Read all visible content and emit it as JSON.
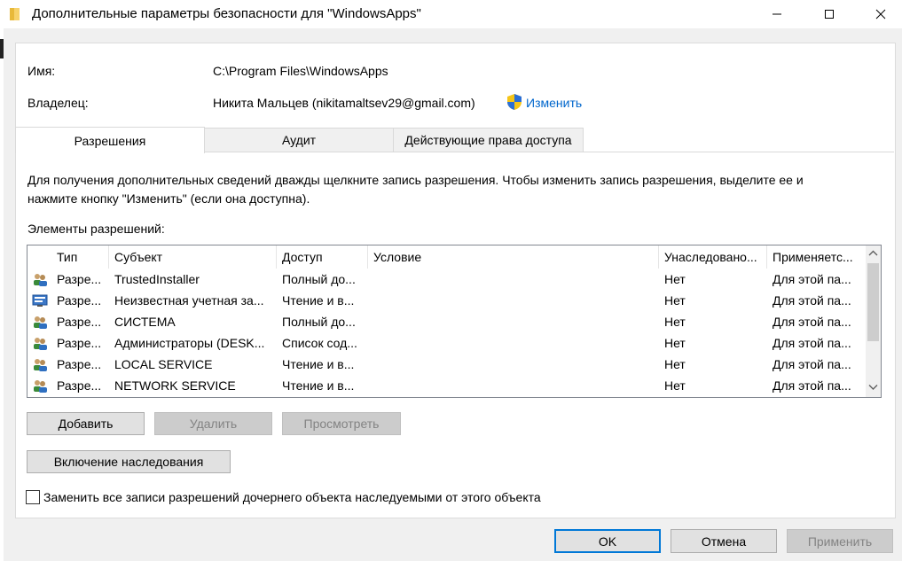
{
  "window": {
    "title": "Дополнительные параметры безопасности  для \"WindowsApps\"",
    "icon": "folder-icon"
  },
  "info": {
    "name_label": "Имя:",
    "name_value": "C:\\Program Files\\WindowsApps",
    "owner_label": "Владелец:",
    "owner_value": "Никита Мальцев (nikitamaltsev29@gmail.com)",
    "change_link": "Изменить"
  },
  "tabs": [
    {
      "label": "Разрешения",
      "active": true
    },
    {
      "label": "Аудит",
      "active": false
    },
    {
      "label": "Действующие права доступа",
      "active": false
    }
  ],
  "description": {
    "line1": "Для получения дополнительных сведений дважды щелкните запись разрешения. Чтобы изменить запись разрешения, выделите ее и",
    "line2": "нажмите кнопку \"Изменить\" (если она доступна)."
  },
  "permissions": {
    "section_label": "Элементы разрешений:",
    "columns": [
      "Тип",
      "Субъект",
      "Доступ",
      "Условие",
      "Унаследовано...",
      "Применяетс..."
    ],
    "rows": [
      {
        "icon": "users-icon",
        "type": "Разре...",
        "subject": "TrustedInstaller",
        "access": "Полный до...",
        "condition": "",
        "inherited": "Нет",
        "applies": "Для этой па..."
      },
      {
        "icon": "computer-account-icon",
        "type": "Разре...",
        "subject": "Неизвестная учетная за...",
        "access": "Чтение и в...",
        "condition": "",
        "inherited": "Нет",
        "applies": "Для этой па..."
      },
      {
        "icon": "users-icon",
        "type": "Разре...",
        "subject": "СИСТЕМА",
        "access": "Полный до...",
        "condition": "",
        "inherited": "Нет",
        "applies": "Для этой па..."
      },
      {
        "icon": "users-icon",
        "type": "Разре...",
        "subject": "Администраторы (DESK...",
        "access": "Список сод...",
        "condition": "",
        "inherited": "Нет",
        "applies": "Для этой па..."
      },
      {
        "icon": "users-icon",
        "type": "Разре...",
        "subject": "LOCAL SERVICE",
        "access": "Чтение и в...",
        "condition": "",
        "inherited": "Нет",
        "applies": "Для этой па..."
      },
      {
        "icon": "users-icon",
        "type": "Разре...",
        "subject": "NETWORK SERVICE",
        "access": "Чтение и в...",
        "condition": "",
        "inherited": "Нет",
        "applies": "Для этой па..."
      }
    ]
  },
  "buttons": {
    "add": "Добавить",
    "remove": "Удалить",
    "view": "Просмотреть",
    "enable_inheritance": "Включение наследования",
    "ok": "OK",
    "cancel": "Отмена",
    "apply": "Применить"
  },
  "replace_checkbox": {
    "label": "Заменить все записи разрешений дочернего объекта наследуемыми от этого объекта",
    "checked": false
  },
  "colors": {
    "link": "#0066cc",
    "accent": "#0078d7"
  }
}
